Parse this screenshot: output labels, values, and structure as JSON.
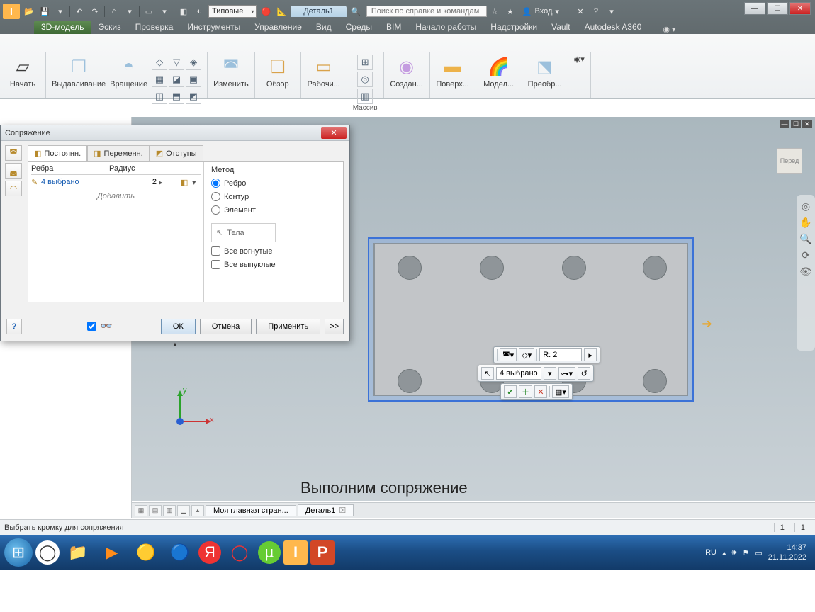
{
  "qat": {
    "style_combo": "Типовые",
    "doc_tab": "Деталь1",
    "search_placeholder": "Поиск по справке и командам",
    "login": "Вход"
  },
  "ribbon_tabs": [
    "3D-модель",
    "Эскиз",
    "Проверка",
    "Инструменты",
    "Управление",
    "Вид",
    "Среды",
    "BIM",
    "Начало работы",
    "Надстройки",
    "Vault",
    "Autodesk A360"
  ],
  "ribbon": {
    "start": "Начать",
    "extrude": "Выдавливание",
    "revolve": "Вращение",
    "modify": "Изменить",
    "explore": "Обзор",
    "work": "Рабочи...",
    "array": "Массив",
    "create": "Создан...",
    "surface": "Поверх...",
    "model": "Модел...",
    "convert": "Преобр..."
  },
  "dialog": {
    "title": "Сопряжение",
    "tabs": [
      "Постоянн.",
      "Переменн.",
      "Отступы"
    ],
    "col_edges": "Ребра",
    "col_radius": "Радиус",
    "selected_text": "4 выбрано",
    "radius_value": "2",
    "add_row": "Добавить",
    "method_label": "Метод",
    "method_options": [
      "Ребро",
      "Контур",
      "Элемент"
    ],
    "bodies_label": "Тела",
    "all_concave": "Все вогнутые",
    "all_convex": "Все выпуклые",
    "ok": "ОК",
    "cancel": "Отмена",
    "apply": "Применить",
    "more": ">>"
  },
  "mini_toolbar": {
    "radius_prefix": "R:",
    "radius_value": "2",
    "selection": "4 выбрано"
  },
  "triad": {
    "x": "x",
    "y": "y"
  },
  "view_cube_face": "Перед",
  "caption": "Выполним сопряжение",
  "docstrip": {
    "tab1": "Моя главная стран...",
    "tab2": "Деталь1"
  },
  "statusbar": {
    "msg": "Выбрать кромку для сопряжения",
    "num1": "1",
    "num2": "1"
  },
  "taskbar": {
    "lang": "RU",
    "time": "14:37",
    "date": "21.11.2022"
  }
}
